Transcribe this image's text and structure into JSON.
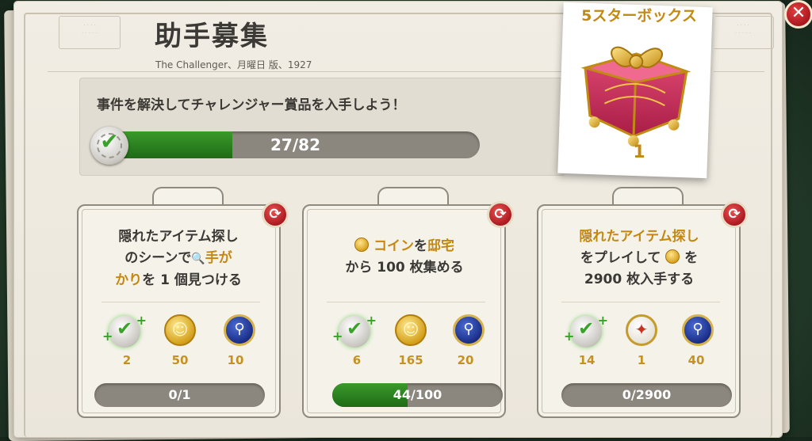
{
  "header": {
    "title": "助手募集",
    "subtitle": "The Challenger、月曜日 版、1927"
  },
  "objective": {
    "text": "事件を解決してチャレンジャー賞品を入手しよう！",
    "progress_label": "27/82",
    "progress_fraction": 0.3293
  },
  "reward": {
    "title": "5スターボックス",
    "count": "1"
  },
  "tasks": [
    {
      "desc_line1": "隠れたアイテム探し",
      "desc_line2a": "のシーンで",
      "desc_line2b": "手が",
      "desc_line3a": "かり",
      "desc_line3b": "を 1 個見つける",
      "rewards": [
        "2",
        "50",
        "10"
      ],
      "progress_label": "0/1",
      "progress_fraction": 0
    },
    {
      "desc_line1a": "コイン",
      "desc_line1b": "を",
      "desc_line1c": "邸宅",
      "desc_line2": "から 100 枚集める",
      "rewards": [
        "6",
        "165",
        "20"
      ],
      "progress_label": "44/100",
      "progress_fraction": 0.44
    },
    {
      "desc_line1": "隠れたアイテム探し",
      "desc_line2a": "をプレイして",
      "desc_line2b": "を",
      "desc_line3": "2900 枚入手する",
      "rewards": [
        "14",
        "1",
        "40"
      ],
      "progress_label": "0/2900",
      "progress_fraction": 0
    }
  ],
  "icons": {
    "close": "close-icon",
    "refresh": "refresh-icon",
    "check": "check-token-icon",
    "coin": "coin-icon",
    "magnifier": "magnifier-medal-icon",
    "compass": "compass-icon",
    "gift": "gift-box-icon"
  },
  "colors": {
    "progress_green": "#2a8a1f",
    "highlight_gold": "#c48812",
    "refresh_red": "#b5161f"
  }
}
